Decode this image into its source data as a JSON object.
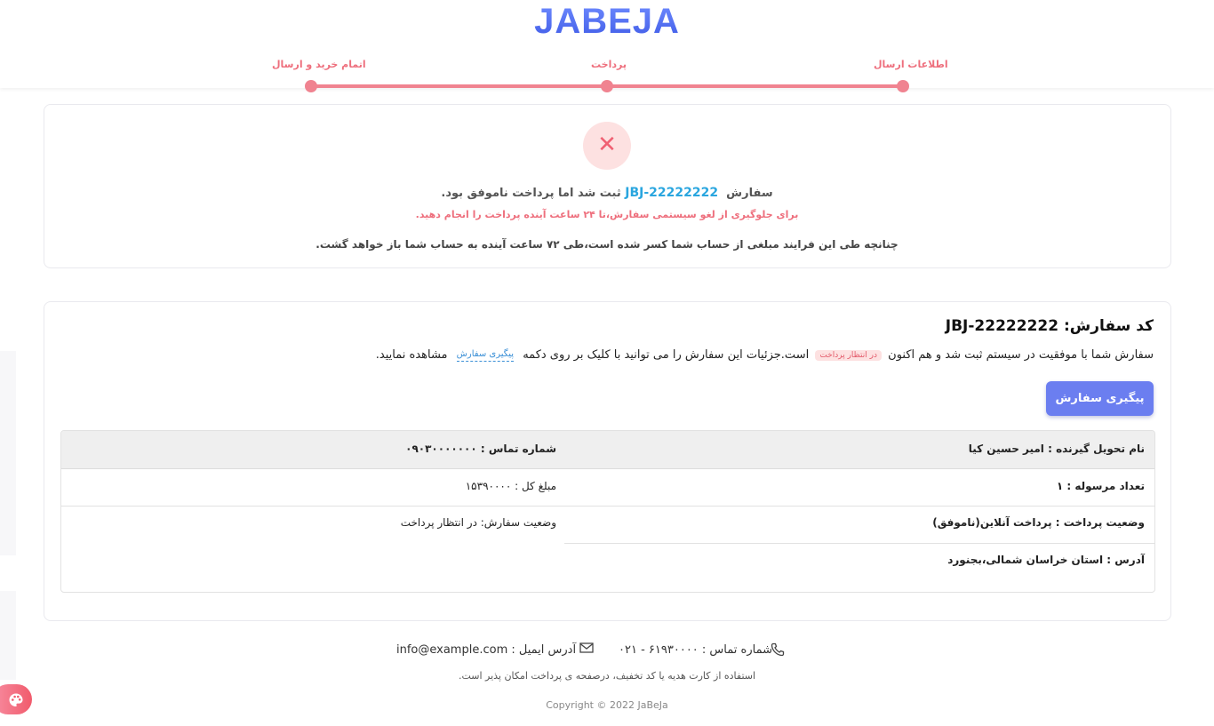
{
  "header": {
    "logo": "JABEJA",
    "steps": [
      {
        "label": "اطلاعات ارسال"
      },
      {
        "label": "پرداخت"
      },
      {
        "label": "اتمام خرید و ارسال"
      }
    ]
  },
  "failure": {
    "icon": "close-icon",
    "line1_pre": "سفارش",
    "order_code": "JBJ-22222222",
    "line1_post": "ثبت شد اما پرداخت ناموفق بود.",
    "line2": "برای جلوگیری از لغو سیستمی سفارش،تا ۲۴ ساعت آینده پرداخت را انجام دهید.",
    "line3": "چنانچه طی این فرایند مبلغی از حساب شما کسر شده است،طی ۷۲ ساعت آینده به حساب شما باز خواهد گشت."
  },
  "order": {
    "title": "کد سفارش: JBJ-22222222",
    "msg_part1": "سفارش شما با موفقیت در سیستم ثبت شد و هم اکنون",
    "status_badge": "در انتظار پرداخت",
    "msg_part2": "است.جزئیات این سفارش را می توانید با کلیک بر روی دکمه",
    "track_link": "پیگیری سفارش",
    "msg_part3": "مشاهده نمایید.",
    "track_button": "پیگیری سفارش",
    "details": {
      "recipient": "نام تحویل گیرنده : امیر حسین کیا",
      "phone": "شماره تماس : ۰۹۰۳۰۰۰۰۰۰۰",
      "count": "تعداد مرسوله : ۱",
      "total": "مبلغ کل : ۱۵۳۹۰۰۰۰",
      "payment_status": "وضعیت پرداخت : پرداخت آنلاین(ناموفق)",
      "order_status": "وضعیت سفارش: در انتظار پرداخت",
      "address": "آدرس : استان خراسان شمالی،بجنورد"
    }
  },
  "footer": {
    "phone": "شماره تماس : ۶۱۹۳۰۰۰۰ - ۰۲۱",
    "email": "آدرس ایمیل : info@example.com",
    "note": "استفاده از کارت هدیه یا کد تخفیف، درصفحه ی پرداخت امکان پذیر است.",
    "copyright": "Copyright © 2022 JaBeJa"
  },
  "colors": {
    "accent": "#6b7ef0",
    "error": "#ee6f7d",
    "link": "#2aa6df"
  }
}
